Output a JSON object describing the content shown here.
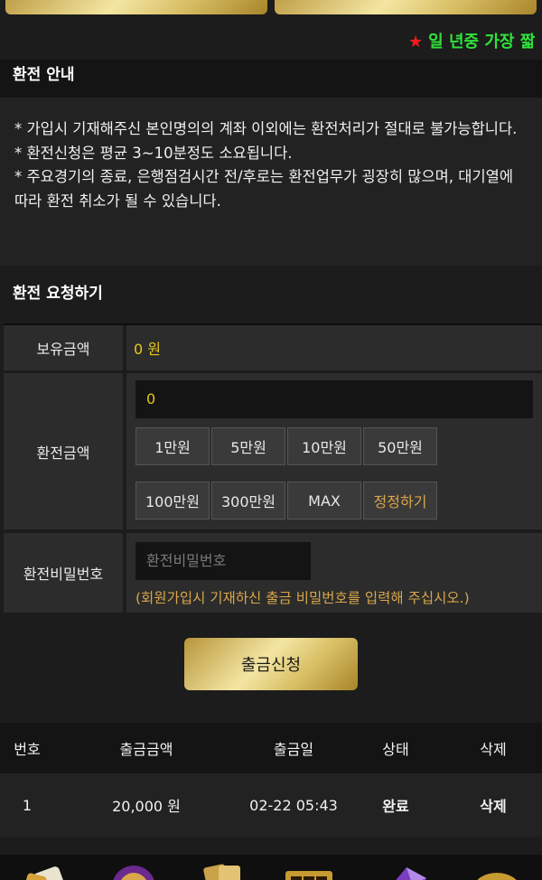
{
  "ticker": {
    "text": "일 년중 가장 짧"
  },
  "notice": {
    "title": "환전 안내",
    "lines": [
      "* 가입시 기재해주신 본인명의의 계좌 이외에는 환전처리가 절대로 불가능합니다.",
      "* 환전신청은 평균 3~10분정도 소요됩니다.",
      "* 주요경기의 종료, 은행점검시간 전/후로는 환전업무가 굉장히 많으며, 대기열에 따라 환전 취소가 될 수 있습니다."
    ]
  },
  "request": {
    "title": "환전 요청하기",
    "balance_label": "보유금액",
    "balance_value": "0 원",
    "amount_label": "환전금액",
    "amount_value": "0",
    "amount_buttons": [
      "1만원",
      "5만원",
      "10만원",
      "50만원",
      "100만원",
      "300만원",
      "MAX",
      "정정하기"
    ],
    "password_label": "환전비밀번호",
    "password_placeholder": "환전비밀번호",
    "password_hint": "(회원가입시 기재하신 출금 비밀번호를 입력해 주십시오.)",
    "submit_label": "출금신청"
  },
  "history": {
    "columns": [
      "번호",
      "출금금액",
      "출금일",
      "상태",
      "삭제"
    ],
    "rows": [
      {
        "no": "1",
        "amount": "20,000 원",
        "date": "02-22 05:43",
        "status": "완료",
        "delete": "삭제"
      }
    ]
  },
  "colors": {
    "accent_gold": "#d7bd63",
    "balance_yellow": "#e8c81a",
    "hint_orange": "#d9a64a",
    "ticker_green": "#2fe33a"
  },
  "bottom_nav": {
    "icons": [
      "dice-icon",
      "roulette-chip-icon",
      "cards-icon",
      "slot-machine-icon",
      "gem-icon",
      "roulette-wheel-icon"
    ]
  }
}
